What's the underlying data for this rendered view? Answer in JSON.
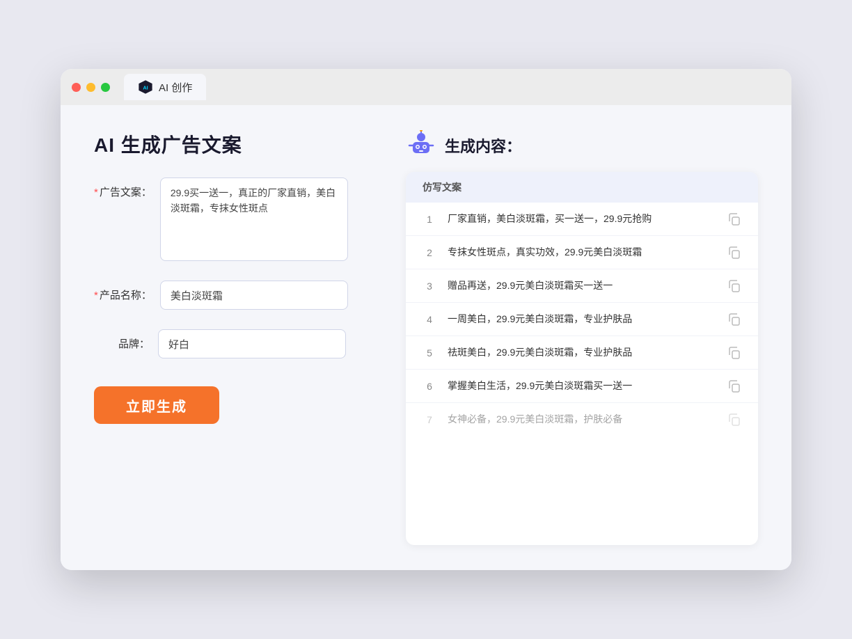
{
  "browser": {
    "tab_label": "AI 创作",
    "traffic_lights": [
      "red",
      "yellow",
      "green"
    ]
  },
  "left_panel": {
    "title": "AI 生成广告文案",
    "fields": [
      {
        "id": "ad_copy",
        "label": "广告文案：",
        "required": true,
        "type": "textarea",
        "value": "29.9买一送一，真正的厂家直销，美白淡斑霜，专抹女性斑点"
      },
      {
        "id": "product_name",
        "label": "产品名称：",
        "required": true,
        "type": "input",
        "value": "美白淡斑霜"
      },
      {
        "id": "brand",
        "label": "品牌：",
        "required": false,
        "type": "input",
        "value": "好白"
      }
    ],
    "generate_button": "立即生成"
  },
  "right_panel": {
    "title": "生成内容：",
    "table_header": "仿写文案",
    "results": [
      {
        "num": "1",
        "text": "厂家直销，美白淡斑霜，买一送一，29.9元抢购",
        "dimmed": false
      },
      {
        "num": "2",
        "text": "专抹女性斑点，真实功效，29.9元美白淡斑霜",
        "dimmed": false
      },
      {
        "num": "3",
        "text": "赠品再送，29.9元美白淡斑霜买一送一",
        "dimmed": false
      },
      {
        "num": "4",
        "text": "一周美白，29.9元美白淡斑霜，专业护肤品",
        "dimmed": false
      },
      {
        "num": "5",
        "text": "祛斑美白，29.9元美白淡斑霜，专业护肤品",
        "dimmed": false
      },
      {
        "num": "6",
        "text": "掌握美白生活，29.9元美白淡斑霜买一送一",
        "dimmed": false
      },
      {
        "num": "7",
        "text": "女神必备，29.9元美白淡斑霜，护肤必备",
        "dimmed": true
      }
    ]
  }
}
